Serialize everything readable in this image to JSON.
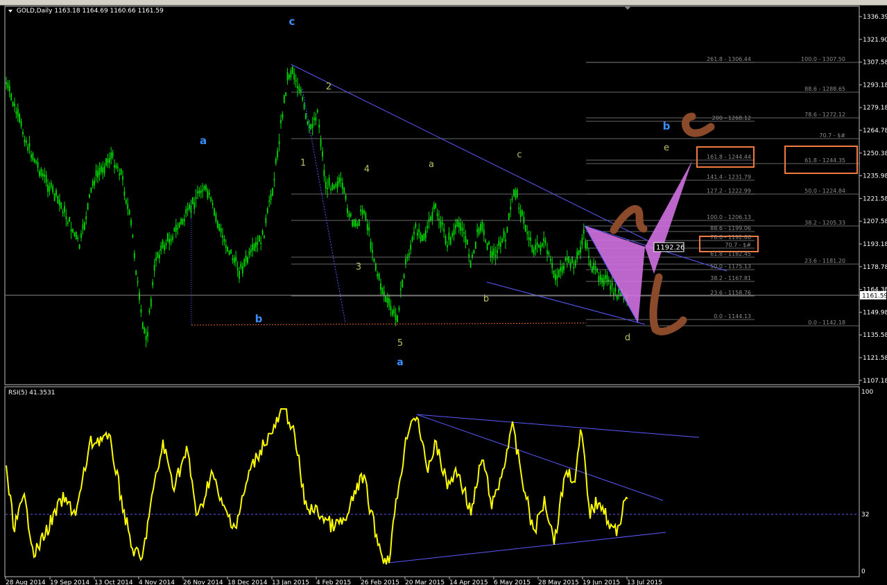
{
  "header": {
    "symbol": "GOLD,Daily",
    "ohlc": "1163.18 1164.69 1160.66 1161.59"
  },
  "price_axis": {
    "ticks": [
      "1336.39",
      "1321.90",
      "1307.58",
      "1293.18",
      "1279.18",
      "1264.78",
      "1250.38",
      "1235.98",
      "1221.58",
      "1207.58",
      "1193.18",
      "1178.78",
      "1164.38",
      "1149.98",
      "1135.58",
      "1121.58",
      "1107.18"
    ],
    "current_price": "1161.59"
  },
  "time_axis": {
    "labels": [
      "28 Aug 2014",
      "19 Sep 2014",
      "13 Oct 2014",
      "4 Nov 2014",
      "26 Nov 2014",
      "18 Dec 2014",
      "13 Jan 2015",
      "4 Feb 2015",
      "26 Feb 2015",
      "20 Mar 2015",
      "14 Apr 2015",
      "6 May 2015",
      "28 May 2015",
      "19 Jun 2015",
      "13 Jul 2015"
    ]
  },
  "rsi": {
    "label": "RSI(5) 41.3531",
    "axis": [
      "100",
      "32",
      "0"
    ]
  },
  "wave_labels": [
    "c",
    "a",
    "b",
    "a",
    "1",
    "2",
    "3",
    "4",
    "5",
    "a",
    "b",
    "c",
    "d",
    "b",
    "e"
  ],
  "fib_left": [
    "261.8 - 1306.44",
    "200 - 1268.12",
    "161.8 - 1244.44",
    "141.4 - 1231.79",
    "127.2 - 1222.99",
    "100.0 - 1206.13",
    "88.6 - 1199.06",
    "78.6 - 1192.86",
    "70.7 - $#",
    "61.8 - 1182.45",
    "50.0 - 1175.13",
    "38.2 - 1167.81",
    "23.6 - 1158.76",
    "0.0 - 1144.13"
  ],
  "fib_right": [
    "100.0 - 1307.50",
    "88.6 - 1288.65",
    "78.6 - 1272.12",
    "70.7 - $#",
    "61.8 - 1244.35",
    "50.0 - 1224.84",
    "38.2 - 1205.33",
    "23.6 - 1181.20",
    "0.0 - 1142.18"
  ],
  "price_box": "1192.26",
  "colors": {
    "background": "#000000",
    "candles": "#00dd00",
    "rsi_line": "#ffff00",
    "trendline": "#5a5aff",
    "fib": "#8c8c8c",
    "wave_blue": "#3a8fff",
    "wave_yellow": "#bfbf60",
    "pattern": "#d070e0",
    "annotation": "#f07a40",
    "brown_marker": "#8b4a2a"
  }
}
